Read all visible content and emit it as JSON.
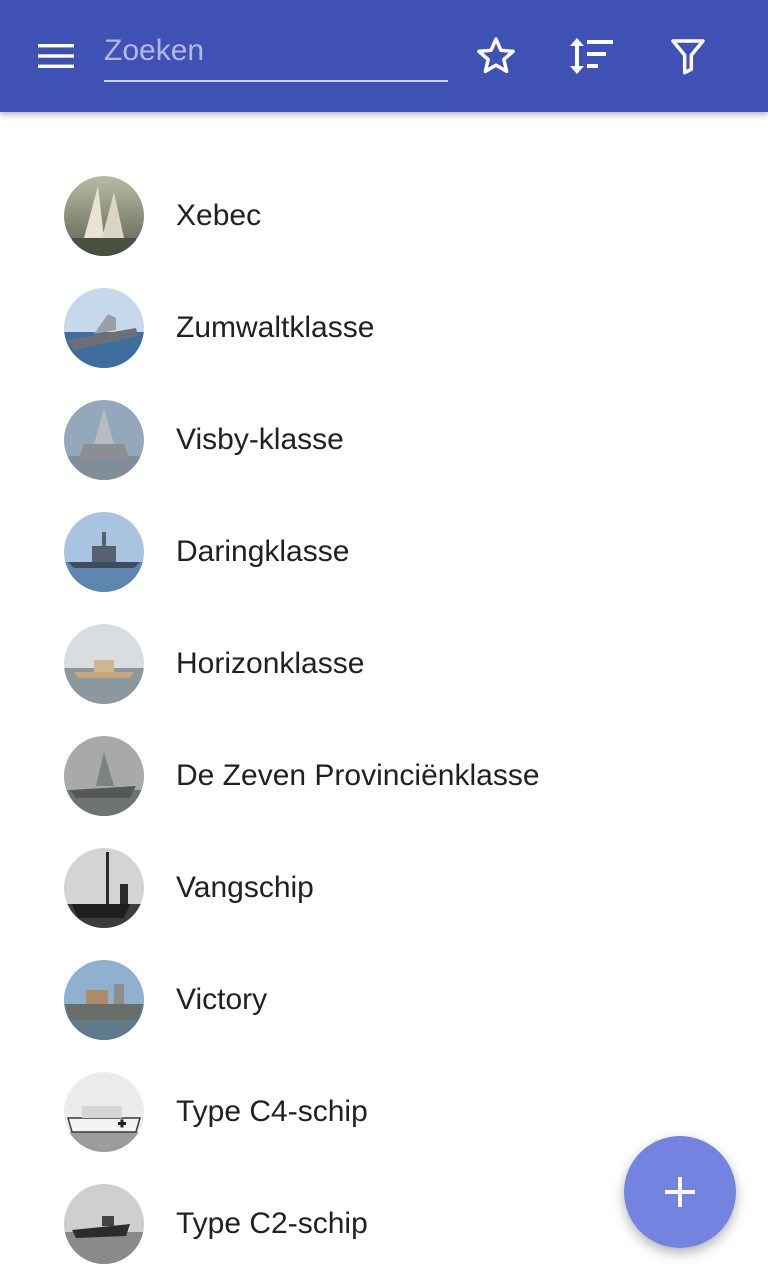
{
  "appbar": {
    "color": "#3f51b5",
    "menu_icon": "hamburger-menu-icon",
    "search": {
      "placeholder": "Zoeken",
      "value": ""
    },
    "actions": [
      {
        "name": "favorites",
        "icon": "star-outline-icon"
      },
      {
        "name": "sort",
        "icon": "sort-icon"
      },
      {
        "name": "filter",
        "icon": "filter-icon"
      }
    ]
  },
  "list": {
    "items": [
      {
        "label": "Xebec",
        "thumb_icon": "ship-photo-thumbnail"
      },
      {
        "label": "Zumwaltklasse",
        "thumb_icon": "ship-photo-thumbnail"
      },
      {
        "label": "Visby-klasse",
        "thumb_icon": "ship-photo-thumbnail"
      },
      {
        "label": "Daringklasse",
        "thumb_icon": "ship-photo-thumbnail"
      },
      {
        "label": "Horizonklasse",
        "thumb_icon": "ship-photo-thumbnail"
      },
      {
        "label": "De Zeven Provinciënklasse",
        "thumb_icon": "ship-photo-thumbnail"
      },
      {
        "label": "Vangschip",
        "thumb_icon": "ship-photo-thumbnail"
      },
      {
        "label": "Victory",
        "thumb_icon": "ship-photo-thumbnail"
      },
      {
        "label": "Type C4-schip",
        "thumb_icon": "ship-photo-thumbnail"
      },
      {
        "label": "Type C2-schip",
        "thumb_icon": "ship-photo-thumbnail"
      }
    ]
  },
  "fab": {
    "icon": "plus-icon",
    "color": "#7482e0"
  }
}
